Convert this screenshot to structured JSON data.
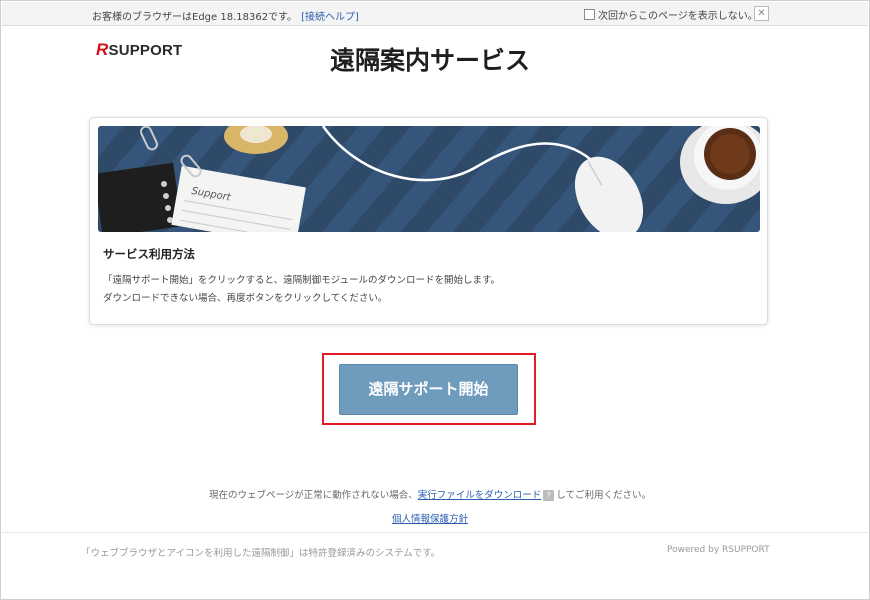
{
  "topbar": {
    "browser_message": "お客様のブラウザーはEdge 18.18362です。",
    "help_link": "[接続ヘルプ]",
    "hide_option": "次回からこのページを表示しない。",
    "close_label": "✕"
  },
  "header": {
    "logo_r": "R",
    "logo_text": "SUPPORT",
    "title": "遠隔案内サービス"
  },
  "card": {
    "banner_notepad_text": "Support",
    "heading": "サービス利用方法",
    "line1": "「遠隔サポート開始」をクリックすると、遠隔制御モジュールのダウンロードを開始します。",
    "line2": "ダウンロードできない場合、再度ボタンをクリックしてください。"
  },
  "start_button": {
    "label": "遠隔サポート開始"
  },
  "help": {
    "prefix": "現在のウェブページが正常に動作されない場合、",
    "download_link": "実行ファイルをダウンロード",
    "qmark": "?",
    "suffix": "してご利用ください。"
  },
  "privacy_link": "個人情報保護方針",
  "footer": {
    "left": "「ウェブブラウザとアイコンを利用した遠隔制御」は特許登録済みのシステムです。",
    "right": "Powered by RSUPPORT"
  },
  "colors": {
    "brand_red": "#d0121b",
    "button_blue": "#6f9bbd",
    "highlight_red": "#e01b24",
    "link_blue": "#2a5db0",
    "banner_navy": "#2f4a68"
  }
}
